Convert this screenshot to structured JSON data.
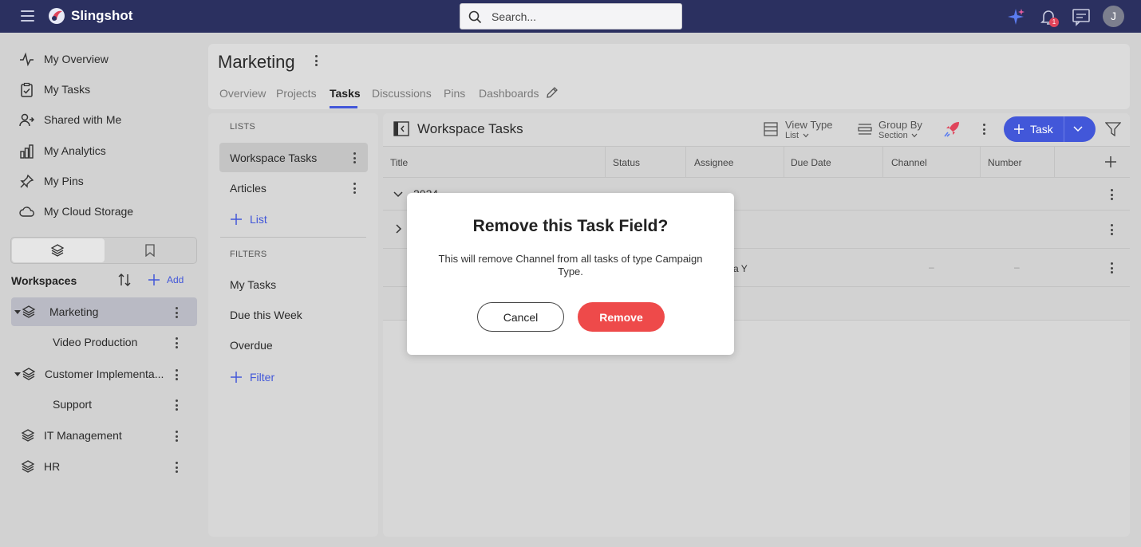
{
  "app": {
    "name": "Slingshot",
    "brand_color": "#2b3060",
    "accent_color": "#4257d9"
  },
  "search": {
    "placeholder": "Search..."
  },
  "topbar": {
    "notification_count": "1",
    "avatar_initial": "J",
    "icons": [
      "sparkle-icon",
      "bell-icon",
      "chat-icon"
    ]
  },
  "nav": {
    "items": [
      {
        "label": "My Overview",
        "icon": "activity-icon"
      },
      {
        "label": "My Tasks",
        "icon": "clipboard-icon"
      },
      {
        "label": "Shared with Me",
        "icon": "user-share-icon"
      },
      {
        "label": "My Analytics",
        "icon": "bar-chart-icon"
      },
      {
        "label": "My Pins",
        "icon": "pin-icon"
      },
      {
        "label": "My Cloud Storage",
        "icon": "cloud-icon"
      }
    ]
  },
  "workspaces": {
    "header": "Workspaces",
    "add_label": "Add",
    "items": [
      {
        "label": "Marketing"
      },
      {
        "label": "Video Production"
      },
      {
        "label": "Customer Implementa..."
      },
      {
        "label": "Support"
      },
      {
        "label": "IT Management"
      },
      {
        "label": "HR"
      }
    ]
  },
  "page": {
    "title": "Marketing",
    "tabs": [
      "Overview",
      "Projects",
      "Tasks",
      "Discussions",
      "Pins",
      "Dashboards"
    ],
    "active_tab": "Tasks"
  },
  "lists": {
    "section_label": "LISTS",
    "items": [
      "Workspace Tasks",
      "Articles"
    ],
    "add_label": "List",
    "filters_label": "FILTERS",
    "filters": [
      "My Tasks",
      "Due this Week",
      "Overdue"
    ],
    "add_filter_label": "Filter"
  },
  "tasks": {
    "title": "Workspace Tasks",
    "view_type_label": "View Type",
    "view_type_value": "List",
    "group_by_label": "Group By",
    "group_by_value": "Section",
    "new_task_label": "Task",
    "columns": [
      "Title",
      "Status",
      "Assignee",
      "Due Date",
      "Channel",
      "Number"
    ],
    "group_label": "2024",
    "row_assignee_fragment": "a Y"
  },
  "modal": {
    "title": "Remove this Task Field?",
    "body": "This will remove Channel from all tasks of type Campaign Type.",
    "cancel_label": "Cancel",
    "confirm_label": "Remove",
    "confirm_color": "#ee4a4a"
  }
}
